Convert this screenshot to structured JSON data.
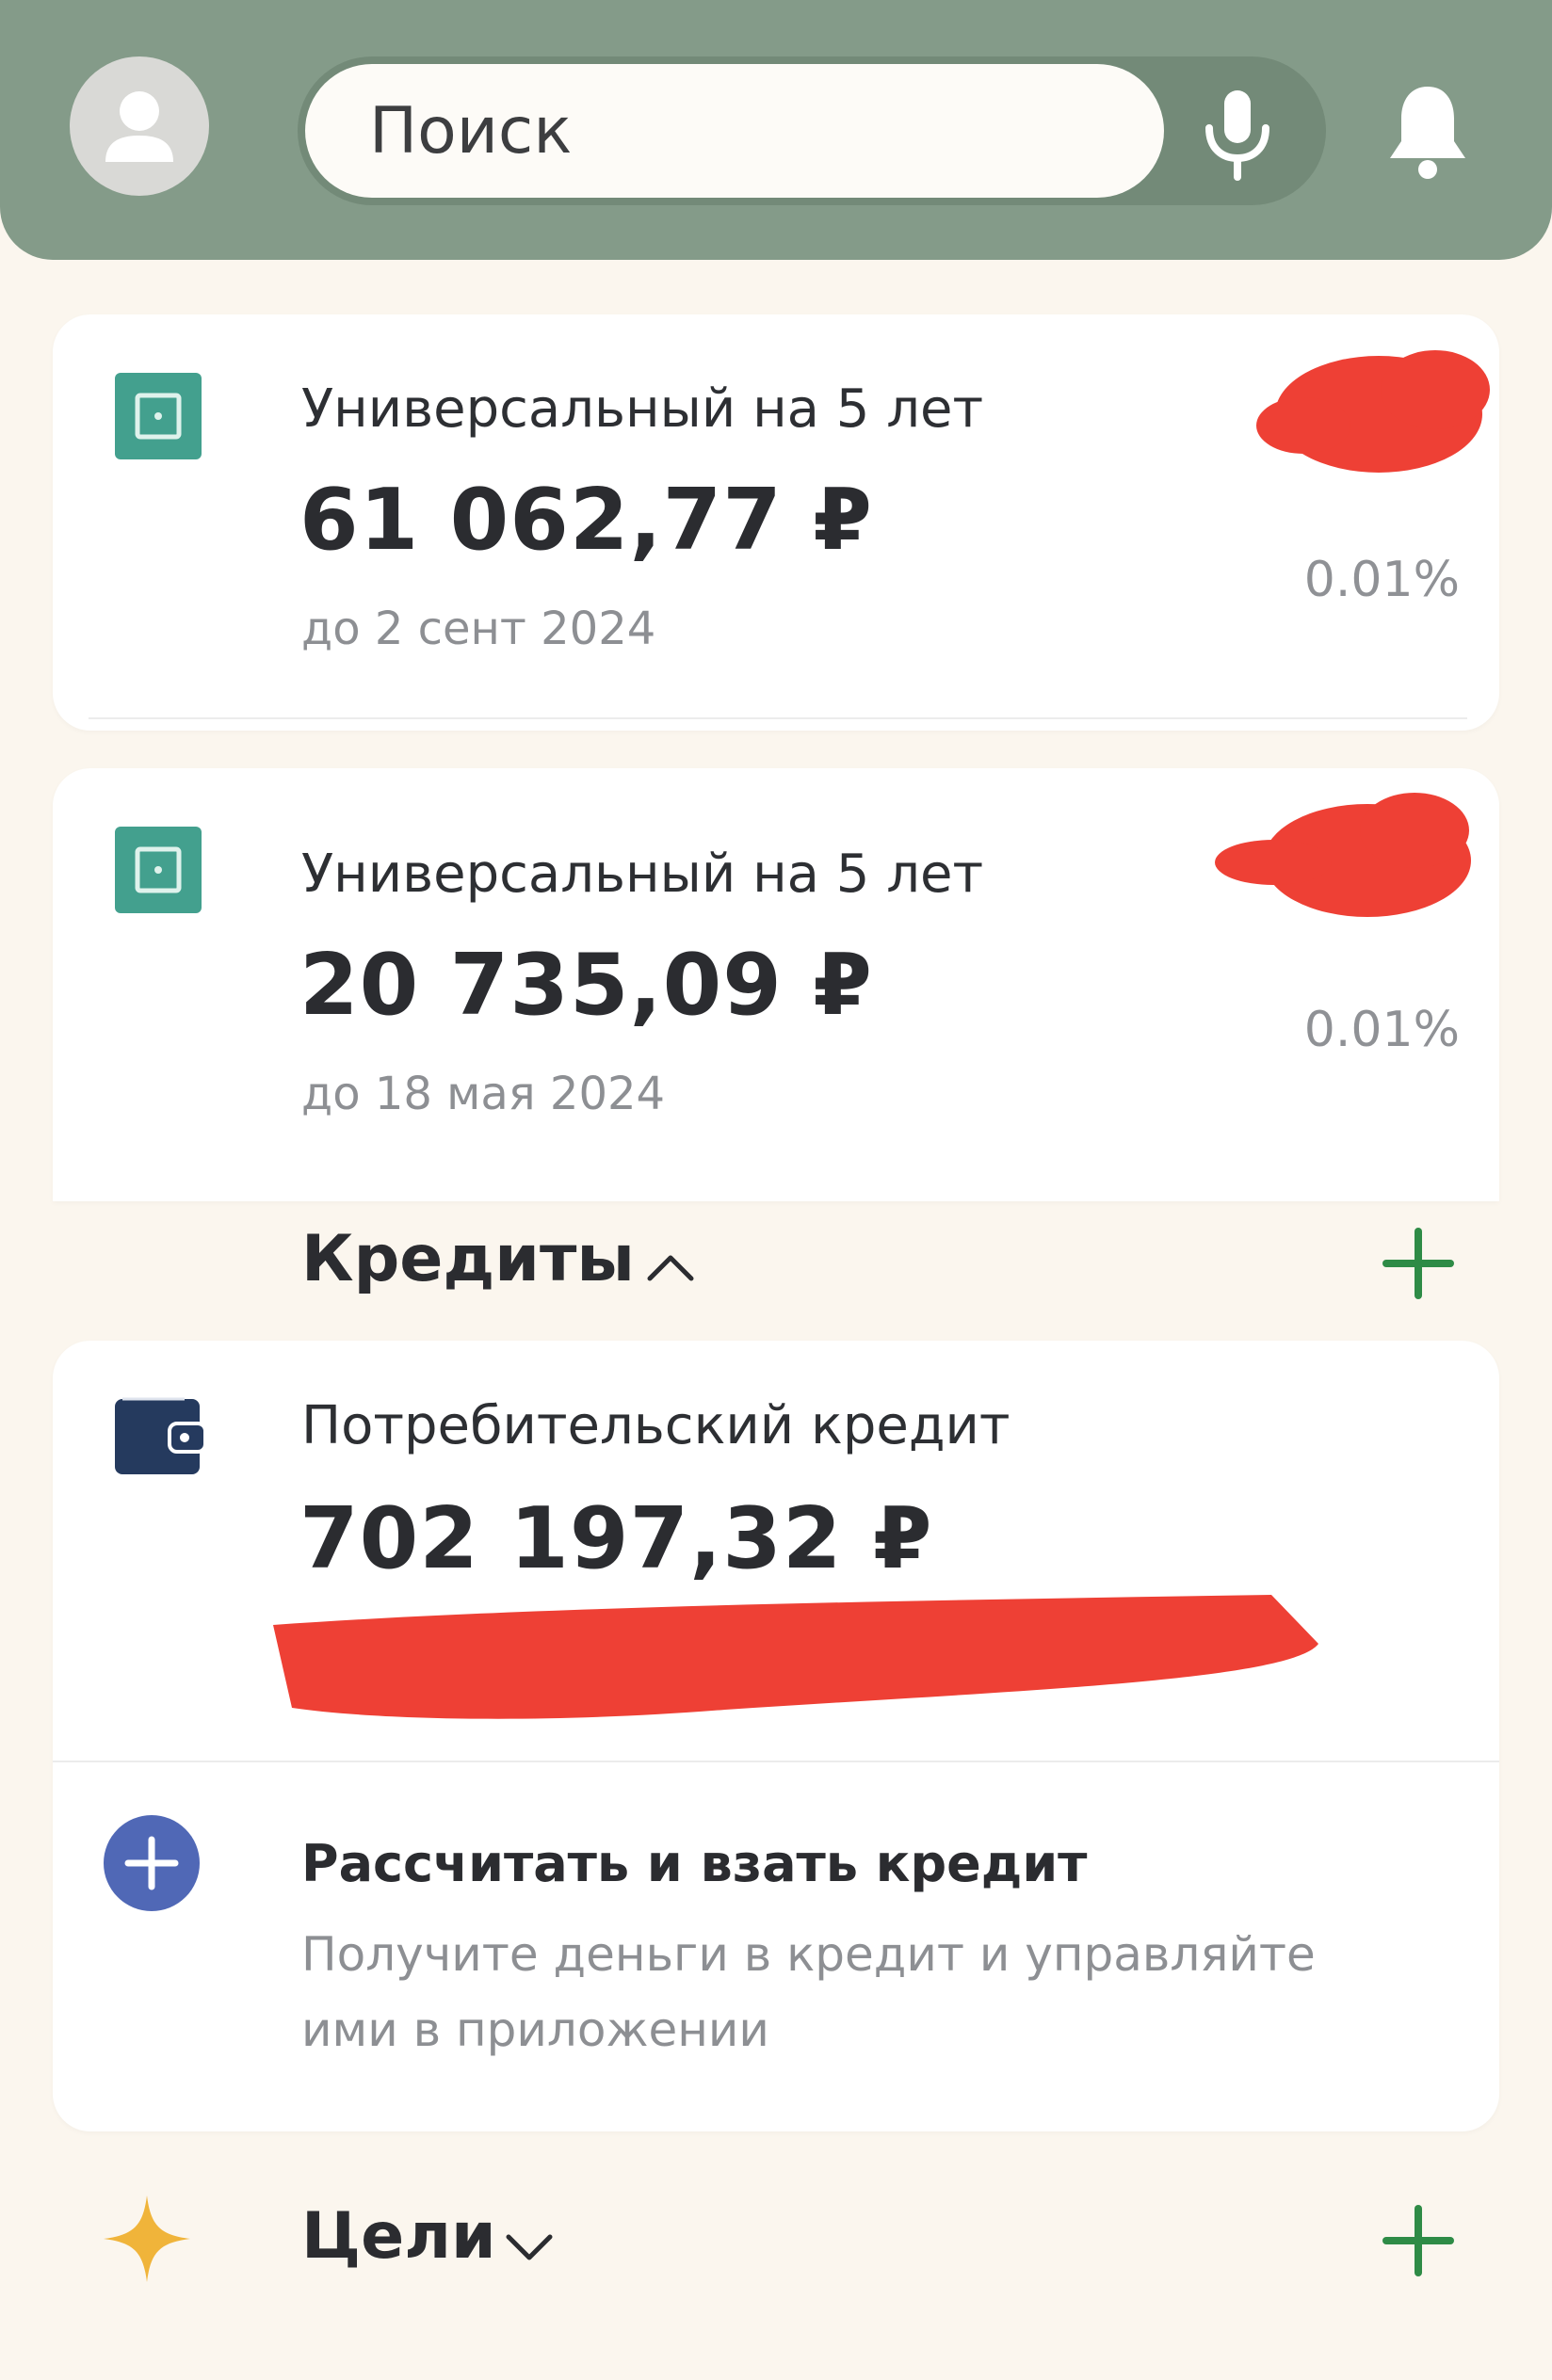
{
  "header": {
    "search_placeholder": "Поиск",
    "avatar_icon": "user-icon",
    "mic_icon": "mic-icon",
    "bell_icon": "bell-icon",
    "bg_color": "#849b89"
  },
  "deposits": [
    {
      "title": "Универсальный на 5 лет",
      "amount": "61 062,77 ₽",
      "until": "до 2 сент 2024",
      "rate": "0.01%"
    },
    {
      "title": "Универсальный на 5 лет",
      "amount": "20 735,09 ₽",
      "until": "до 18 мая 2024",
      "rate": "0.01%"
    }
  ],
  "credits": {
    "section_title": "Кредиты",
    "loan": {
      "title": "Потребительский кредит",
      "amount": "702 197,32 ₽"
    },
    "calc": {
      "title": "Рассчитать и взать кредит",
      "description": "Получите деньги в кредит и управляйте ими в приложении"
    }
  },
  "goals": {
    "section_title": "Цели"
  },
  "colors": {
    "accent_green": "#2e8b46",
    "deposit_teal": "#43a08e",
    "wallet_navy": "#253a5e",
    "plus_blue": "#5068b6",
    "star_gold": "#f0b43a",
    "redaction_red": "#ee4035"
  }
}
